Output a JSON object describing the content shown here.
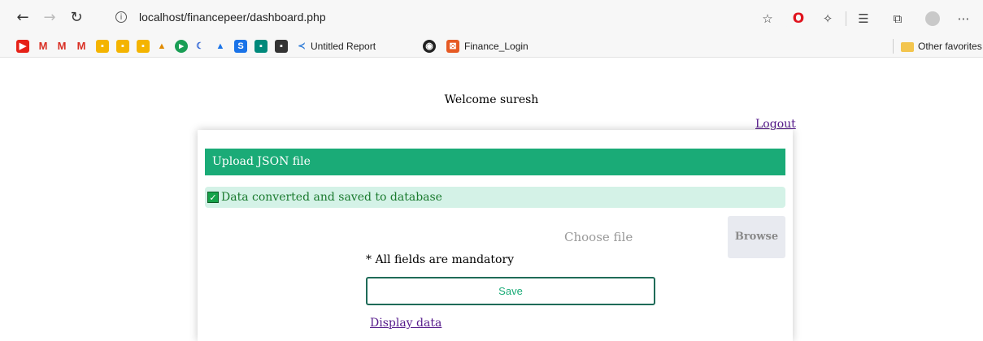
{
  "browser": {
    "url": "localhost/financepeer/dashboard.php",
    "bookmarks": {
      "untitled_report": "Untitled Report",
      "finance_login": "Finance_Login",
      "other_favorites": "Other favorites"
    },
    "icons": [
      "back-arrow-icon",
      "forward-arrow-icon",
      "refresh-icon",
      "info-icon",
      "add-favorite-icon",
      "opera-icon",
      "extensions-icon",
      "favorites-icon",
      "collections-icon",
      "profile-avatar",
      "more-icon"
    ]
  },
  "page": {
    "welcome": "Welcome suresh",
    "logout": "Logout",
    "card": {
      "header": "Upload JSON file",
      "alert": "Data converted and saved to database",
      "choose_file": "Choose file",
      "browse": "Browse",
      "mandatory_note": "* All fields are mandatory",
      "save": "Save",
      "display_data": "Display data"
    }
  },
  "colors": {
    "header_green": "#1aab77",
    "alert_bg": "#d4f2e7",
    "alert_text": "#1a7a2e",
    "link_purple": "#551a8b",
    "save_border": "#1f6b58"
  }
}
